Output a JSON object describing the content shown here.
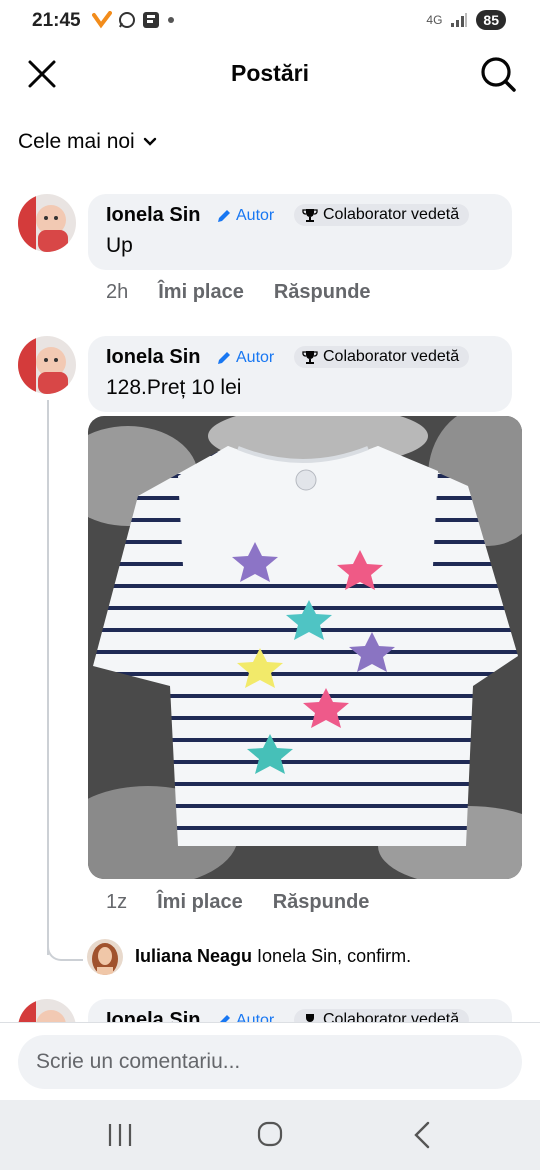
{
  "status_bar": {
    "time": "21:45",
    "network": "4G",
    "battery": "85"
  },
  "header": {
    "title": "Postări"
  },
  "sort": {
    "label": "Cele mai noi"
  },
  "comments": [
    {
      "name": "Ionela Sin",
      "author_label": "Autor",
      "badge": "Colaborator vedetă",
      "text": "Up",
      "time": "2h",
      "like": "Îmi place",
      "reply": "Răspunde"
    },
    {
      "name": "Ionela Sin",
      "author_label": "Autor",
      "badge": "Colaborator vedetă",
      "text": "128.Preț 10 lei",
      "time": "1z",
      "like": "Îmi place",
      "reply": "Răspunde"
    },
    {
      "name": "Ionela Sin",
      "author_label": "Autor",
      "badge": "Colaborator vedetă"
    }
  ],
  "reply": {
    "name": "Iuliana Neagu",
    "text": "Ionela Sin, confirm."
  },
  "composer": {
    "placeholder": "Scrie un comentariu..."
  },
  "colors": {
    "accent": "#1877f2",
    "bubble": "#f0f2f5",
    "muted": "#65676b"
  }
}
